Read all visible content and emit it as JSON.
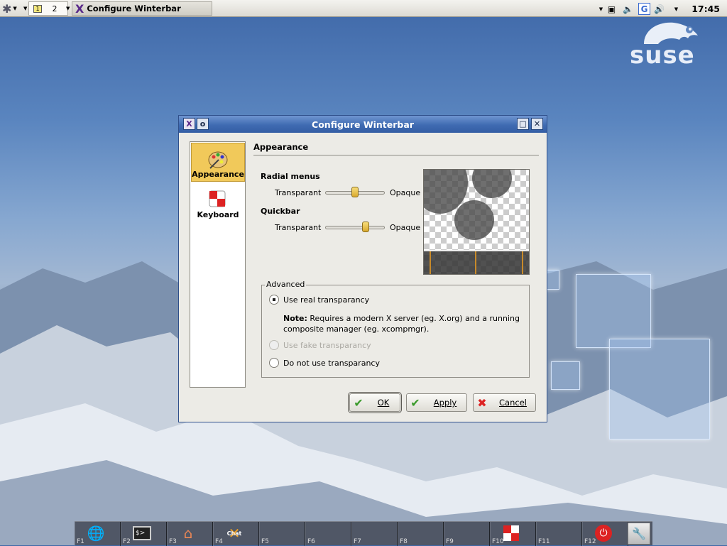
{
  "top_panel": {
    "workspaces": [
      "1",
      "2"
    ],
    "active_workspace": "1",
    "task_title": "Configure Winterbar",
    "clock": "17:45",
    "icons": [
      "gear-menu-icon",
      "notes-icon",
      "volume-icon",
      "google-icon",
      "speaker-icon"
    ]
  },
  "dialog": {
    "title": "Configure Winterbar",
    "sidebar": [
      {
        "label": "Appearance",
        "icon": "palette-icon",
        "selected": true
      },
      {
        "label": "Keyboard",
        "icon": "keyboard-icon",
        "selected": false
      }
    ],
    "page_title": "Appearance",
    "radial": {
      "heading": "Radial menus",
      "left_label": "Transparant",
      "right_label": "Opaque",
      "level": 0.5
    },
    "quickbar": {
      "heading": "Quickbar",
      "left_label": "Transparant",
      "right_label": "Opaque",
      "level": 0.7
    },
    "advanced": {
      "legend": "Advanced",
      "options": [
        {
          "label": "Use real transparancy",
          "selected": true,
          "disabled": false
        },
        {
          "label": "Use fake transparancy",
          "selected": false,
          "disabled": true
        },
        {
          "label": "Do not use transparancy",
          "selected": false,
          "disabled": false
        }
      ],
      "note_bold": "Note:",
      "note_line1": "Requires a modern X server (eg. X.org) and a running",
      "note_line2": "composite manager (eg. xcompmgr)."
    },
    "buttons": {
      "ok": "OK",
      "apply": "Apply",
      "cancel": "Cancel"
    }
  },
  "bottom_bar": {
    "keys": [
      "F1",
      "F2",
      "F3",
      "F4",
      "F5",
      "F6",
      "F7",
      "F8",
      "F9",
      "F10",
      "F11",
      "F12"
    ],
    "icons": [
      "globe-icon",
      "terminal-icon",
      "home-icon",
      "chat-icon",
      "",
      "",
      "",
      "",
      "",
      "game-icon",
      "",
      "power-icon"
    ],
    "chat_text": "Chat"
  },
  "desktop": {
    "logo_text": "suse"
  }
}
